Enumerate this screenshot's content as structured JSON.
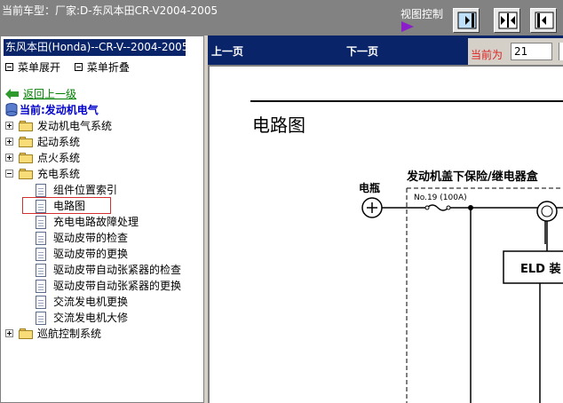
{
  "window": {
    "title": "当前车型：厂家:D-东风本田CR-V2004-2005",
    "view_control_label": "视图控制",
    "view_buttons": [
      "hide-left-pane",
      "split-view",
      "hide-right-pane"
    ]
  },
  "sidebar": {
    "car_header": "东风本田(Honda)--CR-V--2004-2005",
    "menu_expand": "菜单展开",
    "menu_collapse": "菜单折叠",
    "back": "返回上一级",
    "current": "当前:发动机电气",
    "tree": [
      {
        "label": "发动机电气系统",
        "type": "folder",
        "state": "collapsed"
      },
      {
        "label": "起动系统",
        "type": "folder",
        "state": "collapsed"
      },
      {
        "label": "点火系统",
        "type": "folder",
        "state": "collapsed"
      },
      {
        "label": "充电系统",
        "type": "folder",
        "state": "expanded"
      },
      {
        "label": "组件位置索引",
        "type": "doc"
      },
      {
        "label": "电路图",
        "type": "doc",
        "selected": true
      },
      {
        "label": "充电电路故障处理",
        "type": "doc"
      },
      {
        "label": "驱动皮带的检查",
        "type": "doc"
      },
      {
        "label": "驱动皮带的更换",
        "type": "doc"
      },
      {
        "label": "驱动皮带自动张紧器的检查",
        "type": "doc"
      },
      {
        "label": "驱动皮带自动张紧器的更换",
        "type": "doc"
      },
      {
        "label": "交流发电机更换",
        "type": "doc"
      },
      {
        "label": "交流发电机大修",
        "type": "doc"
      },
      {
        "label": "巡航控制系统",
        "type": "folder",
        "state": "collapsed"
      }
    ]
  },
  "nav": {
    "prev": "上一页",
    "next": "下一页",
    "current_label": "当前为",
    "current_page": "21"
  },
  "document": {
    "title": "电路图",
    "battery_label": "电瓶",
    "fuse_box_label": "发动机盖下保险/继电器盒",
    "fuse_label": "No.19 (100A)",
    "eld_label": "ELD 装"
  },
  "colors": {
    "nav_bg": "#0a246a",
    "topbar_bg": "#828282",
    "link_green": "#008000",
    "current_blue": "#0000cc",
    "page_label_red": "#e02020",
    "selection_border": "#d43030"
  }
}
